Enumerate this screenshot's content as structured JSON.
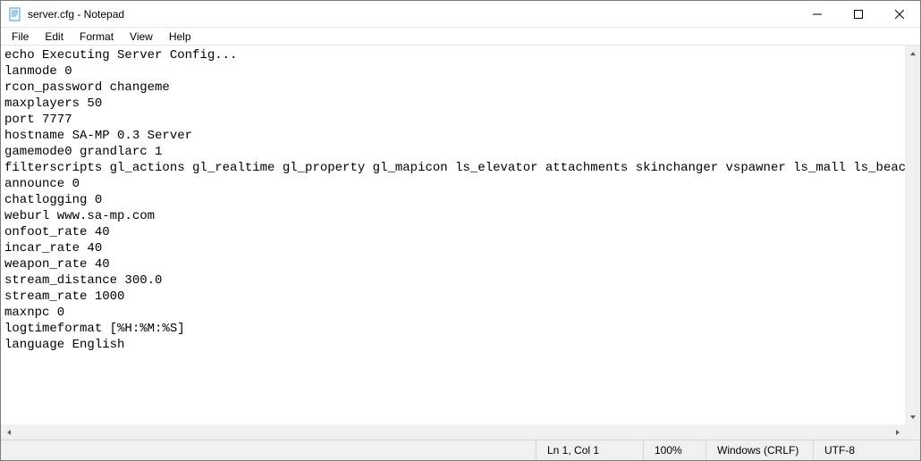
{
  "window": {
    "title": "server.cfg - Notepad"
  },
  "menu": {
    "file": "File",
    "edit": "Edit",
    "format": "Format",
    "view": "View",
    "help": "Help"
  },
  "content_lines": [
    "echo Executing Server Config...",
    "lanmode 0",
    "rcon_password changeme",
    "maxplayers 50",
    "port 7777",
    "hostname SA-MP 0.3 Server",
    "gamemode0 grandlarc 1",
    "filterscripts gl_actions gl_realtime gl_property gl_mapicon ls_elevator attachments skinchanger vspawner ls_mall ls_beachside",
    "announce 0",
    "chatlogging 0",
    "weburl www.sa-mp.com",
    "onfoot_rate 40",
    "incar_rate 40",
    "weapon_rate 40",
    "stream_distance 300.0",
    "stream_rate 1000",
    "maxnpc 0",
    "logtimeformat [%H:%M:%S]",
    "language English"
  ],
  "status": {
    "position": "Ln 1, Col 1",
    "zoom": "100%",
    "line_ending": "Windows (CRLF)",
    "encoding": "UTF-8"
  }
}
